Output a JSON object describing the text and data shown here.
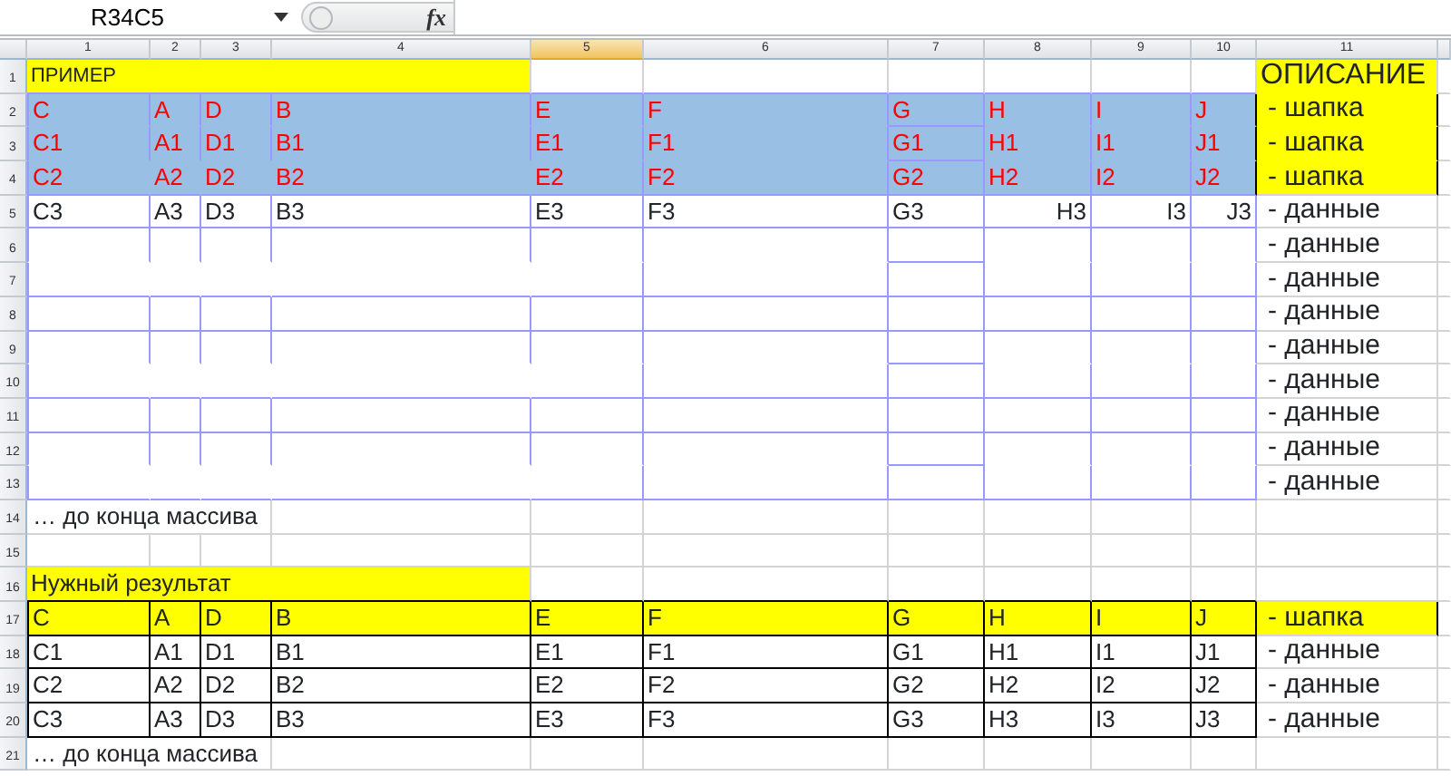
{
  "formula_bar": {
    "name_box": "R34C5",
    "function_label": "fx"
  },
  "column_headers": [
    {
      "label": "1",
      "selected": false
    },
    {
      "label": "2",
      "selected": false
    },
    {
      "label": "3",
      "selected": false
    },
    {
      "label": "4",
      "selected": false
    },
    {
      "label": "5",
      "selected": true
    },
    {
      "label": "6",
      "selected": false
    },
    {
      "label": "7",
      "selected": false
    },
    {
      "label": "8",
      "selected": false
    },
    {
      "label": "9",
      "selected": false
    },
    {
      "label": "10",
      "selected": false
    },
    {
      "label": "11",
      "selected": false
    }
  ],
  "row_numbers": [
    "1",
    "2",
    "3",
    "4",
    "5",
    "6",
    "7",
    "8",
    "9",
    "10",
    "11",
    "12",
    "13",
    "14",
    "15",
    "16",
    "17",
    "18",
    "19",
    "20",
    "21"
  ],
  "example": {
    "title": "ПРИМЕР",
    "header_rows": [
      [
        "C",
        "A",
        "D",
        "B",
        "E",
        "F",
        "G",
        "H",
        "I",
        "J"
      ],
      [
        "C1",
        "A1",
        "D1",
        "B1",
        "E1",
        "F1",
        "G1",
        "H1",
        "I1",
        "J1"
      ],
      [
        "C2",
        "A2",
        "D2",
        "B2",
        "E2",
        "F2",
        "G2",
        "H2",
        "I2",
        "J2"
      ]
    ],
    "data_row": [
      "C3",
      "A3",
      "D3",
      "B3",
      "E3",
      "F3",
      "G3",
      "H3",
      "I3",
      "J3"
    ],
    "footer": "… до конца массива"
  },
  "description": {
    "title": "ОПИСАНИЕ",
    "example_notes": [
      "- шапка",
      "- шапка",
      "- шапка",
      "- данные",
      "- данные",
      "- данные",
      "- данные",
      "- данные",
      "- данные",
      "- данные",
      "- данные",
      "- данные"
    ],
    "result_notes": [
      "- шапка",
      "- данные",
      "- данные",
      "- данные"
    ]
  },
  "result": {
    "title": "Нужный результат",
    "header_row": [
      "C",
      "A",
      "D",
      "B",
      "E",
      "F",
      "G",
      "H",
      "I",
      "J"
    ],
    "data_rows": [
      [
        "C1",
        "A1",
        "D1",
        "B1",
        "E1",
        "F1",
        "G1",
        "H1",
        "I1",
        "J1"
      ],
      [
        "C2",
        "A2",
        "D2",
        "B2",
        "E2",
        "F2",
        "G2",
        "H2",
        "I2",
        "J2"
      ],
      [
        "C3",
        "A3",
        "D3",
        "B3",
        "E3",
        "F3",
        "G3",
        "H3",
        "I3",
        "J3"
      ]
    ],
    "footer": "… до конца массива"
  }
}
